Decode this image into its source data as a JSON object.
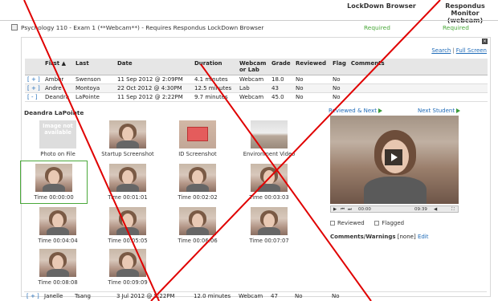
{
  "columns": {
    "lockdown": "LockDown Browser",
    "monitor": "Respondus Monitor (webcam)"
  },
  "exam": {
    "title": "Psychology 110 - Exam 1 (**Webcam**) - Requires Respondus LockDown Browser",
    "lockdown_status": "Required",
    "monitor_status": "Required"
  },
  "panel": {
    "close_label": "×",
    "search_label": "Search",
    "separator": "|",
    "fullscreen_label": "Full Screen"
  },
  "table": {
    "headers": [
      "",
      "First ▲",
      "Last",
      "Date",
      "Duration",
      "Webcam or Lab",
      "Grade",
      "Reviewed",
      "Flag",
      "Comments"
    ],
    "rows": [
      {
        "exp": "[ + ]",
        "first": "Amber",
        "last": "Swenson",
        "date": "11 Sep 2012 @ 2:09PM",
        "duration": "4.1 minutes",
        "webcam": "Webcam",
        "grade": "18.0",
        "reviewed": "No",
        "flag": "No",
        "comments": ""
      },
      {
        "exp": "[ + ]",
        "first": "Andre",
        "last": "Montoya",
        "date": "22 Oct 2012 @ 4:30PM",
        "duration": "12.5 minutes",
        "webcam": "Lab",
        "grade": "43",
        "reviewed": "No",
        "flag": "No",
        "comments": ""
      },
      {
        "exp": "[ - ]",
        "first": "Deandra",
        "last": "LaPointe",
        "date": "11 Sep 2012 @ 2:22PM",
        "duration": "9.7 minutes",
        "webcam": "Webcam",
        "grade": "45.0",
        "reviewed": "No",
        "flag": "No",
        "comments": ""
      }
    ],
    "last_row": {
      "exp": "[ + ]",
      "first": "Janelle",
      "last": "Tsang",
      "date": "3 Jul 2012 @ 5:22PM",
      "duration": "12.0 minutes",
      "webcam": "Webcam",
      "grade": "47",
      "reviewed": "No",
      "flag": "No",
      "comments": ""
    }
  },
  "detail": {
    "student_name": "Deandra LaPointe",
    "photo_placeholder": "Image not available",
    "thumbs_top": [
      "Photo on File",
      "Startup Screenshot",
      "ID Screenshot",
      "Environment Video"
    ],
    "thumbs_times": [
      "Time 00:00:00",
      "Time 00:01:01",
      "Time 00:02:02",
      "Time 00:03:03",
      "Time 00:04:04",
      "Time 00:05:05",
      "Time 00:06:06",
      "Time 00:07:07",
      "Time 00:08:08",
      "Time 00:09:09"
    ],
    "reviewed_next": "Reviewed & Next",
    "next_student": "Next Student",
    "video": {
      "current_time": "00:00",
      "total_time": "09:39",
      "controls": [
        "▶",
        "⏮",
        "⏭"
      ]
    },
    "reviewed_label": "Reviewed",
    "flagged_label": "Flagged",
    "comments_label": "Comments/Warnings",
    "comments_value": "[none]",
    "edit_label": "Edit"
  },
  "colors": {
    "link": "#1f6bb8",
    "required": "#4aa83a",
    "overlay_cross": "#e00000"
  }
}
